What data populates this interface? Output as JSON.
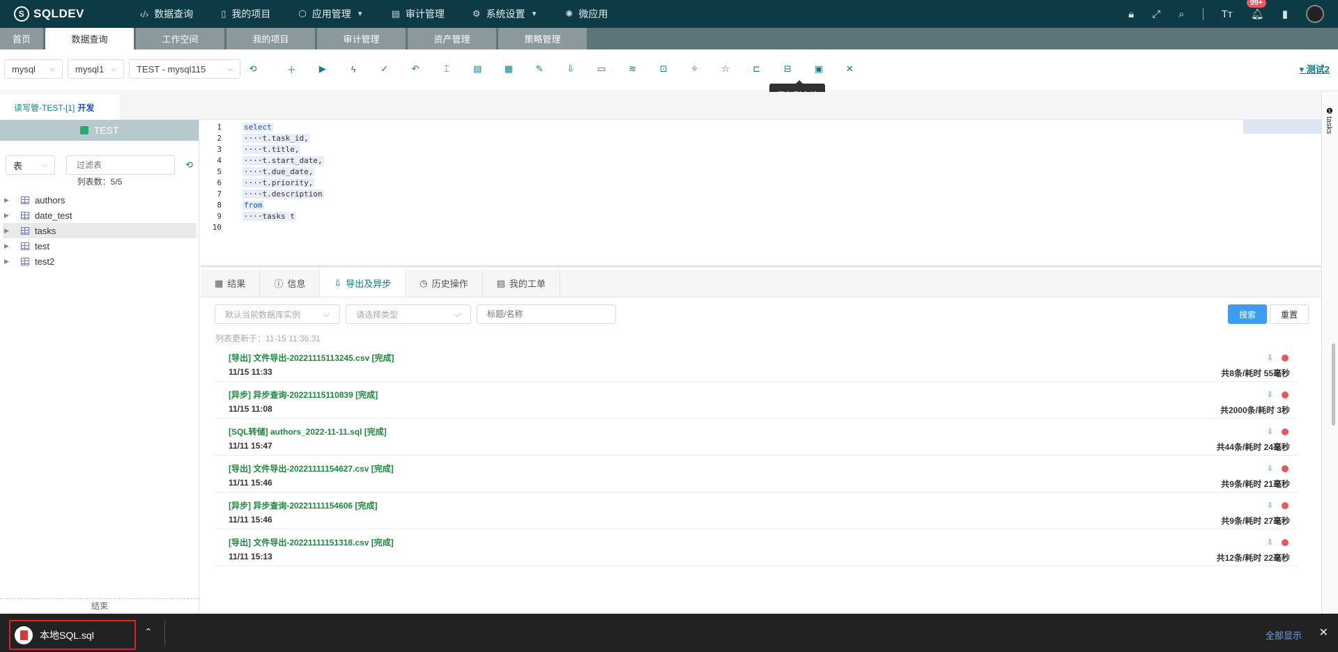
{
  "app": {
    "brand": "SQLDEV"
  },
  "menu": [
    {
      "label": "数据查询",
      "icon": "code-icon",
      "caret": false
    },
    {
      "label": "我的项目",
      "icon": "document-icon",
      "caret": false
    },
    {
      "label": "应用管理",
      "icon": "cube-icon",
      "caret": true
    },
    {
      "label": "审计管理",
      "icon": "clipboard-icon",
      "caret": false
    },
    {
      "label": "系统设置",
      "icon": "gear-icon",
      "caret": true
    },
    {
      "label": "微应用",
      "icon": "atom-icon",
      "caret": false
    }
  ],
  "topright": {
    "notify_badge": "99+"
  },
  "tabs": [
    "首页",
    "数据查询",
    "工作空间",
    "我的项目",
    "审计管理",
    "资产管理",
    "策略管理"
  ],
  "toolbar": {
    "db_type": "mysql",
    "instance": "mysql1",
    "connection": "TEST - mysql115",
    "tooltip": "保存到本地",
    "user": "测试2"
  },
  "doctab": {
    "label": "读写管-TEST-[1]",
    "env": "开发"
  },
  "left": {
    "db_name": "TEST",
    "type_select": "表",
    "filter_placeholder": "过滤表",
    "count_label": "列表数：5/5",
    "tables": [
      "authors",
      "date_test",
      "tasks",
      "test",
      "test2"
    ],
    "footer": "结束"
  },
  "editor": {
    "lines": [
      {
        "n": "1",
        "text": "select",
        "kw": true
      },
      {
        "n": "2",
        "text": "····t.task_id,",
        "kw": false
      },
      {
        "n": "3",
        "text": "····t.title,",
        "kw": false
      },
      {
        "n": "4",
        "text": "····t.start_date,",
        "kw": false
      },
      {
        "n": "5",
        "text": "····t.due_date,",
        "kw": false
      },
      {
        "n": "6",
        "text": "····t.priority,",
        "kw": false
      },
      {
        "n": "7",
        "text": "····t.description",
        "kw": false
      },
      {
        "n": "8",
        "text": "from",
        "kw": true
      },
      {
        "n": "9",
        "text": "····tasks t",
        "kw": false
      },
      {
        "n": "10",
        "text": "",
        "kw": false
      }
    ]
  },
  "rightside": {
    "label": "tasks"
  },
  "bottom": {
    "tabs": [
      {
        "label": "结果",
        "icon": "grid-icon"
      },
      {
        "label": "信息",
        "icon": "info-icon"
      },
      {
        "label": "导出及异步",
        "icon": "export-icon"
      },
      {
        "label": "历史操作",
        "icon": "clock-icon"
      },
      {
        "label": "我的工单",
        "icon": "ticket-icon"
      }
    ],
    "filter_instance": "默认当前数据库实例",
    "filter_type": "请选择类型",
    "filter_title": "标题/名称",
    "search": "搜索",
    "reset": "重置",
    "updated": "列表更新于：11-15 11:36:31",
    "tasks": [
      {
        "title": "[导出] 文件导出-20221115113245.csv [完成]",
        "time": "11/15 11:33",
        "stats": "共8条/耗时 55毫秒"
      },
      {
        "title": "[异步] 异步查询-20221115110839 [完成]",
        "time": "11/15 11:08",
        "stats": "共2000条/耗时 3秒"
      },
      {
        "title": "[SQL转储] authors_2022-11-11.sql [完成]",
        "time": "11/11 15:47",
        "stats": "共44条/耗时 24毫秒"
      },
      {
        "title": "[导出] 文件导出-20221111154627.csv [完成]",
        "time": "11/11 15:46",
        "stats": "共9条/耗时 21毫秒"
      },
      {
        "title": "[异步] 异步查询-20221111154606 [完成]",
        "time": "11/11 15:46",
        "stats": "共9条/耗时 27毫秒"
      },
      {
        "title": "[导出] 文件导出-20221111151318.csv [完成]",
        "time": "11/11 15:13",
        "stats": "共12条/耗时 22毫秒"
      }
    ]
  },
  "download": {
    "file": "本地SQL.sql",
    "show_all": "全部显示"
  }
}
